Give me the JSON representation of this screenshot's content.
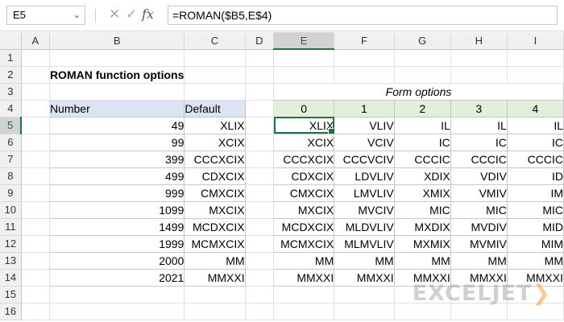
{
  "formula_bar": {
    "name_box": "E5",
    "cancel_icon": "✕",
    "enter_icon": "✓",
    "fx_label": "fx",
    "formula": "=ROMAN($B5,E$4)"
  },
  "sheet": {
    "columns": [
      "A",
      "B",
      "C",
      "D",
      "E",
      "F",
      "G",
      "H",
      "I"
    ],
    "rows": [
      "1",
      "2",
      "3",
      "4",
      "5",
      "6",
      "7",
      "8",
      "9",
      "10",
      "11",
      "12",
      "13",
      "14",
      "15",
      "16"
    ],
    "active_cell": "E5",
    "title": "ROMAN function options",
    "left_table": {
      "headers": [
        "Number",
        "Default"
      ],
      "rows": [
        [
          "49",
          "XLIX"
        ],
        [
          "99",
          "XCIX"
        ],
        [
          "399",
          "CCCXCIX"
        ],
        [
          "499",
          "CDXCIX"
        ],
        [
          "999",
          "CMXCIX"
        ],
        [
          "1099",
          "MXCIX"
        ],
        [
          "1499",
          "MCDXCIX"
        ],
        [
          "1999",
          "MCMXCIX"
        ],
        [
          "2000",
          "MM"
        ],
        [
          "2021",
          "MMXXI"
        ]
      ]
    },
    "right_table": {
      "title": "Form options",
      "headers": [
        "0",
        "1",
        "2",
        "3",
        "4"
      ],
      "rows": [
        [
          "XLIX",
          "VLIV",
          "IL",
          "IL",
          "IL"
        ],
        [
          "XCIX",
          "VCIV",
          "IC",
          "IC",
          "IC"
        ],
        [
          "CCCXCIX",
          "CCCVCIV",
          "CCCIC",
          "CCCIC",
          "CCCIC"
        ],
        [
          "CDXCIX",
          "LDVLIV",
          "XDIX",
          "VDIV",
          "ID"
        ],
        [
          "CMXCIX",
          "LMVLIV",
          "XMIX",
          "VMIV",
          "IM"
        ],
        [
          "MXCIX",
          "MVCIV",
          "MIC",
          "MIC",
          "MIC"
        ],
        [
          "MCDXCIX",
          "MLDVLIV",
          "MXDIX",
          "MVDIV",
          "MID"
        ],
        [
          "MCMXCIX",
          "MLMVLIV",
          "MXMIX",
          "MVMIV",
          "MIM"
        ],
        [
          "MM",
          "MM",
          "MM",
          "MM",
          "MM"
        ],
        [
          "MMXXI",
          "MMXXI",
          "MMXXI",
          "MMXXI",
          "MMXXI"
        ]
      ]
    }
  },
  "colors": {
    "selection": "#217346",
    "header_blue": "#dce4f4",
    "header_green": "#e2efda"
  },
  "watermark": {
    "text": "EXCELJET",
    "icon": "chevron-logo-icon"
  }
}
